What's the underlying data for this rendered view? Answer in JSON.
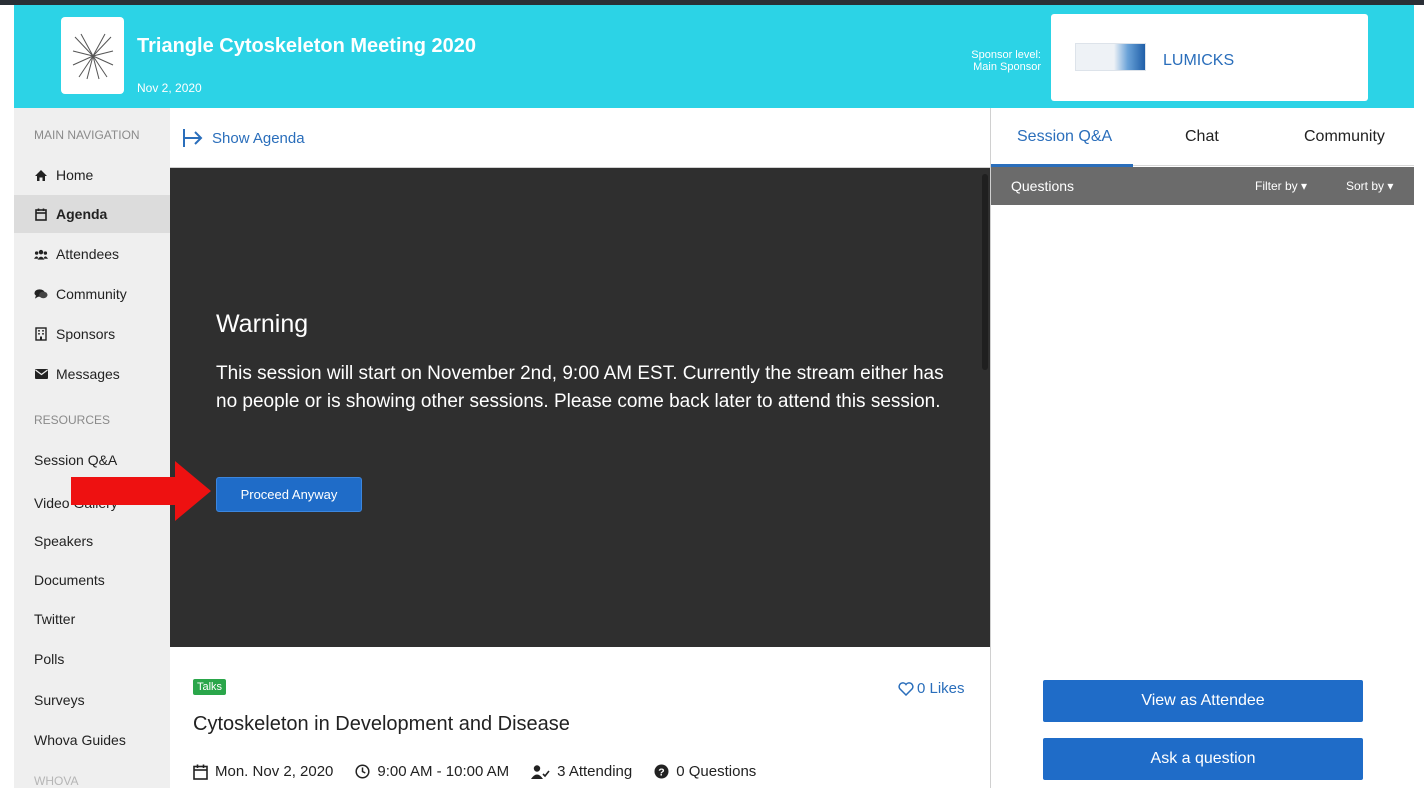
{
  "header": {
    "event_title": "Triangle Cytoskeleton Meeting 2020",
    "event_date": "Nov 2, 2020",
    "sponsor_level_line1": "Sponsor level:",
    "sponsor_level_line2": "Main Sponsor",
    "sponsor_name": "LUMICKS"
  },
  "sidebar": {
    "main_heading": "MAIN NAVIGATION",
    "items": [
      {
        "label": "Home",
        "icon": "home-icon"
      },
      {
        "label": "Agenda",
        "icon": "calendar-icon",
        "active": true
      },
      {
        "label": "Attendees",
        "icon": "users-icon"
      },
      {
        "label": "Community",
        "icon": "comments-icon"
      },
      {
        "label": "Sponsors",
        "icon": "building-icon"
      },
      {
        "label": "Messages",
        "icon": "envelope-icon"
      }
    ],
    "resources_heading": "RESOURCES",
    "resources": [
      "Session Q&A",
      "Video Gallery",
      "Speakers",
      "Documents",
      "Twitter",
      "Polls",
      "Surveys",
      "Whova Guides"
    ],
    "whova_heading": "WHOVA"
  },
  "center": {
    "show_agenda": "Show Agenda",
    "warning_title": "Warning",
    "warning_text": "This session will start on November 2nd, 9:00 AM EST. Currently the stream either has no people or is showing other sessions. Please come back later to attend this session.",
    "proceed_button": "Proceed Anyway",
    "tag": "Talks",
    "likes": "0 Likes",
    "session_title": "Cytoskeleton in Development and Disease",
    "meta": {
      "date": "Mon. Nov 2, 2020",
      "time": "9:00 AM - 10:00 AM",
      "attending": "3 Attending",
      "questions": "0 Questions"
    }
  },
  "right_panel": {
    "tabs": [
      "Session Q&A",
      "Chat",
      "Community"
    ],
    "active_tab": "Session Q&A",
    "questions_label": "Questions",
    "filter_label": "Filter by",
    "sort_label": "Sort by",
    "view_as_attendee": "View as Attendee",
    "ask_question": "Ask a question"
  },
  "colors": {
    "header_bg": "#2cd3e6",
    "accent_blue": "#1f6cc8",
    "link_blue": "#2a6ebb",
    "video_bg": "#2f2f2f",
    "tag_green": "#2aa64a",
    "annotation_arrow": "#ee1111"
  }
}
